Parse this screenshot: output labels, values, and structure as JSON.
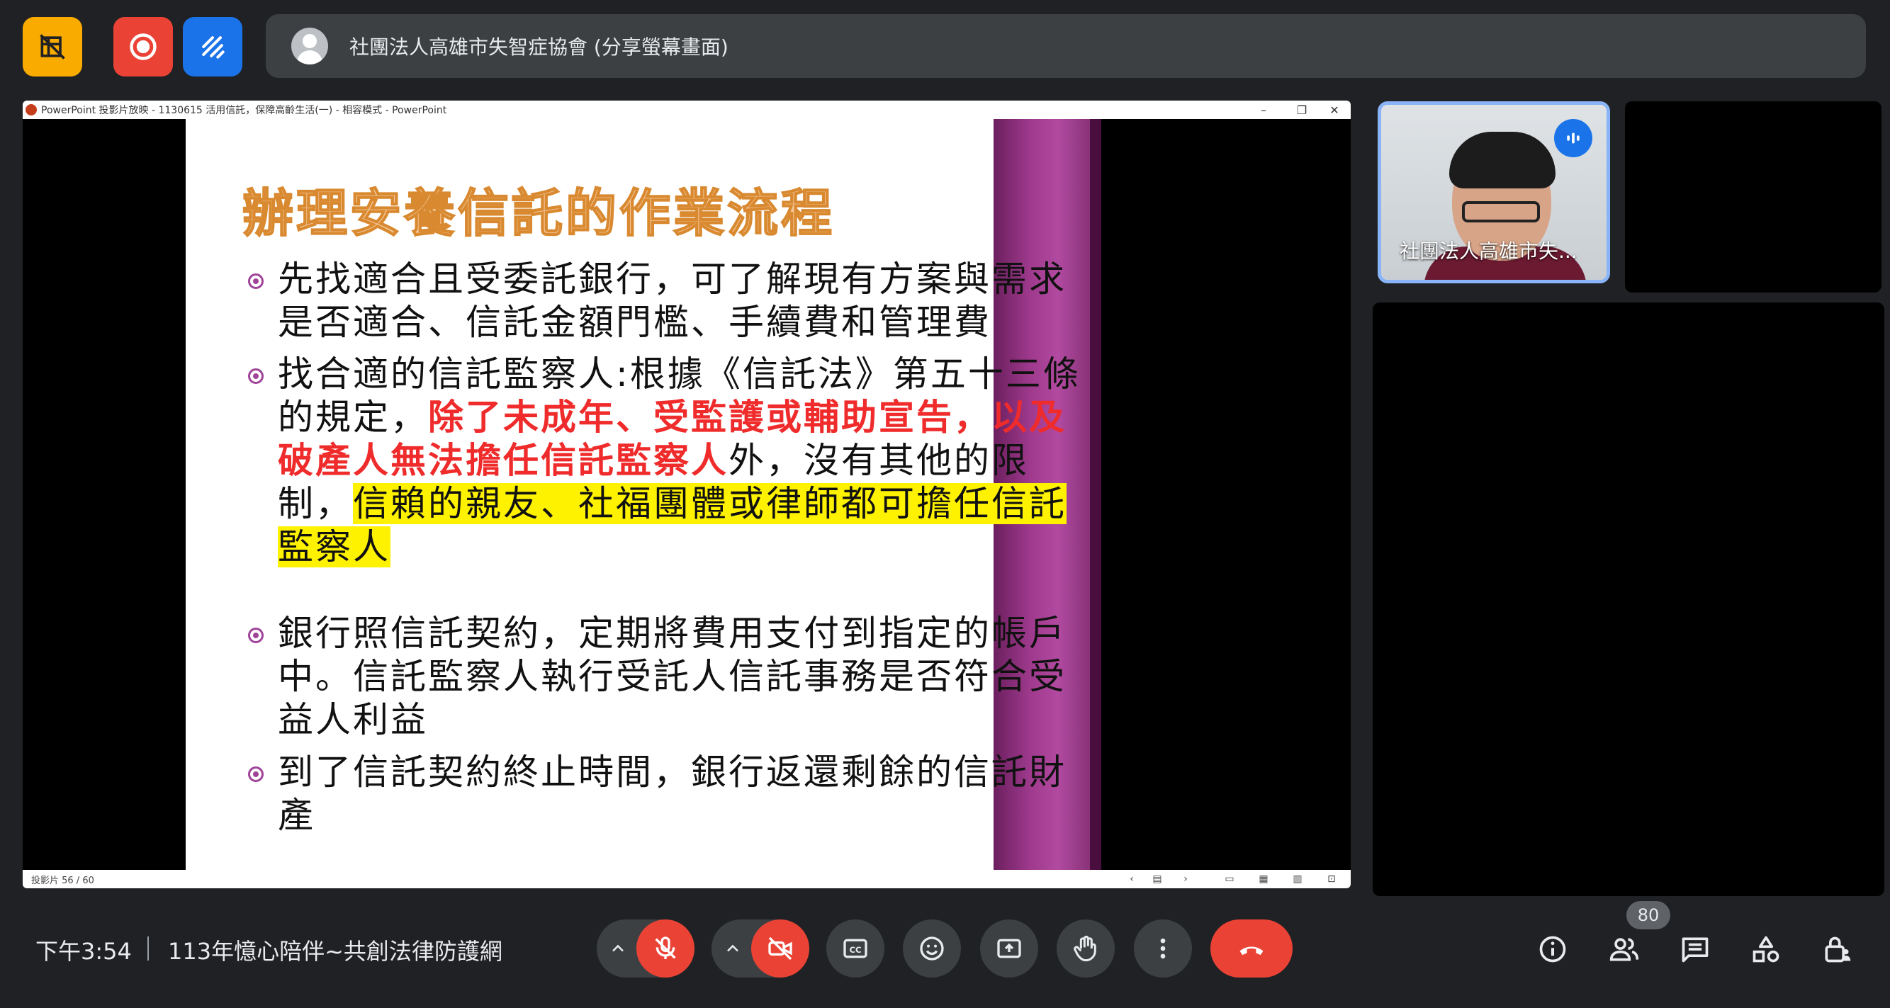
{
  "banner": {
    "title": "社團法人高雄市失智症協會 (分享螢幕畫面)"
  },
  "top_buttons": {
    "colors": {
      "yellow": "#f9ab00",
      "red": "#ea4335",
      "blue": "#1a73e8"
    }
  },
  "ppt_window": {
    "title": "PowerPoint 投影片放映 - 1130615 活用信託，保障高齡生活(一) - 相容模式 - PowerPoint",
    "status": "投影片 56 / 60"
  },
  "slide": {
    "title": "辦理安養信託的作業流程",
    "bullets": [
      {
        "text": "先找適合且受委託銀行，可了解現有方案與需求是否適合、信託金額門檻、手續費和管理費"
      },
      {
        "part1": "找合適的信託監察人:根據《信託法》第五十三條的規定，",
        "red": "除了未成年、受監護或輔助宣告，以及破產人無法擔任信託監察人",
        "part2": "外，沒有其他的限制，",
        "highlight": "信賴的親友、社福團體或律師都可擔任信託監察人"
      },
      {
        "text": "銀行照信託契約，定期將費用支付到指定的帳戶中。信託監察人執行受託人信託事務是否符合受益人利益"
      },
      {
        "text": "到了信託契約終止時間，銀行返還剩餘的信託財產"
      }
    ]
  },
  "participant": {
    "name": "社團法人高雄市失..."
  },
  "bottom": {
    "time": "下午3:54",
    "meeting_name": "113年憶心陪伴~共創法律防護網",
    "participant_count": "80"
  }
}
